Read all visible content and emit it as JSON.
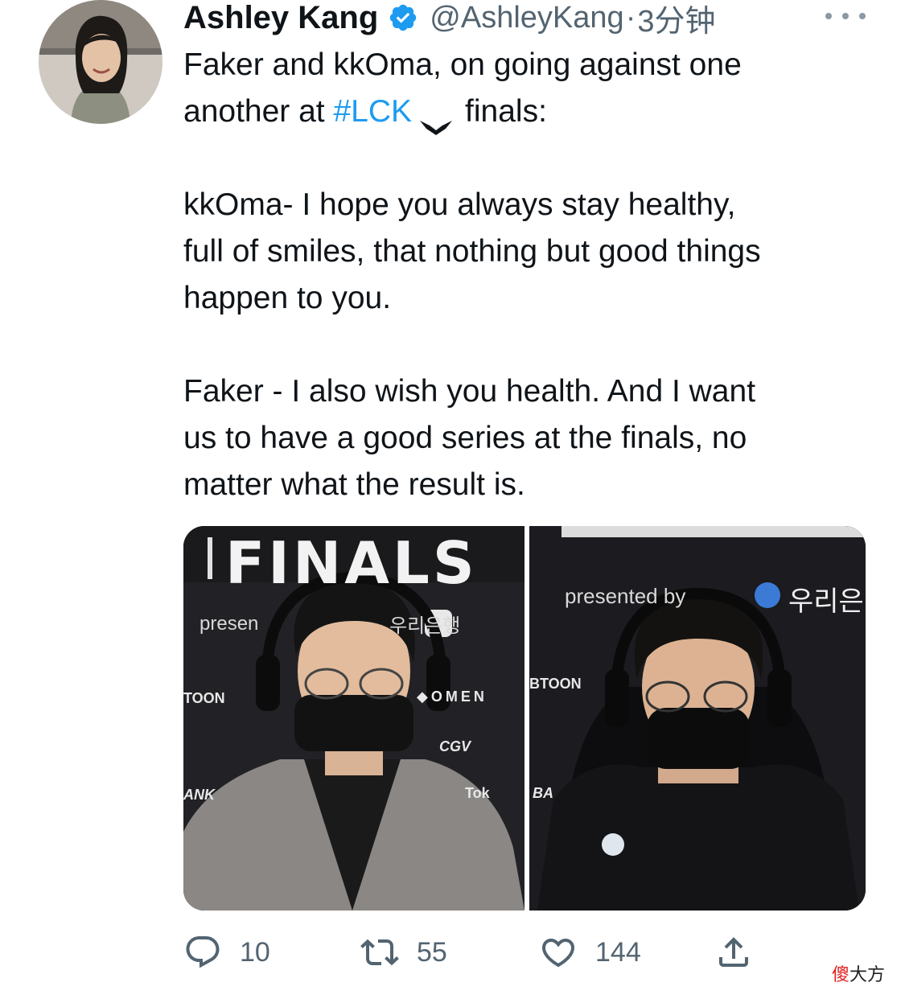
{
  "author": {
    "name": "Ashley Kang",
    "handle": "@AshleyKang",
    "separator": "·",
    "time": "3分钟"
  },
  "tweet": {
    "line1": "Faker and kkOma, on going against one",
    "line2_before": "another at ",
    "line2_hashtag": "#LCK",
    "line2_after": "finals:",
    "para2_line1": "kkOma- I hope you always stay healthy,",
    "para2_line2": "full of smiles, that nothing but good things",
    "para2_line3": "happen to you.",
    "para3_line1": "Faker - I also wish you health. And I want",
    "para3_line2": "us to have a good series at the finals, no",
    "para3_line3": "matter what the result is."
  },
  "media": {
    "left": {
      "banner": "FINALS",
      "presented": "presen",
      "sponsor_korean": "우리은행",
      "sponsor_omen": "◆OMEN",
      "sponsor_toon": "TOON",
      "sponsor_cgv": "CGV",
      "sponsor_ank": "ANK",
      "sponsor_tok": "Tok"
    },
    "right": {
      "presented": "presented by",
      "sponsor_korean": "우리은",
      "sponsor_btoon": "BTOON",
      "sponsor_ba": "BA"
    }
  },
  "actions": {
    "reply_count": "10",
    "retweet_count": "55",
    "like_count": "144"
  },
  "watermark": {
    "red": "傻",
    "dark": "大方"
  },
  "colors": {
    "link": "#1d9bf0",
    "text": "#0f1419",
    "muted": "#536471"
  },
  "icons": [
    "verified-badge-icon",
    "more-icon",
    "lck-bird-icon",
    "reply-icon",
    "retweet-icon",
    "like-icon",
    "share-icon"
  ]
}
